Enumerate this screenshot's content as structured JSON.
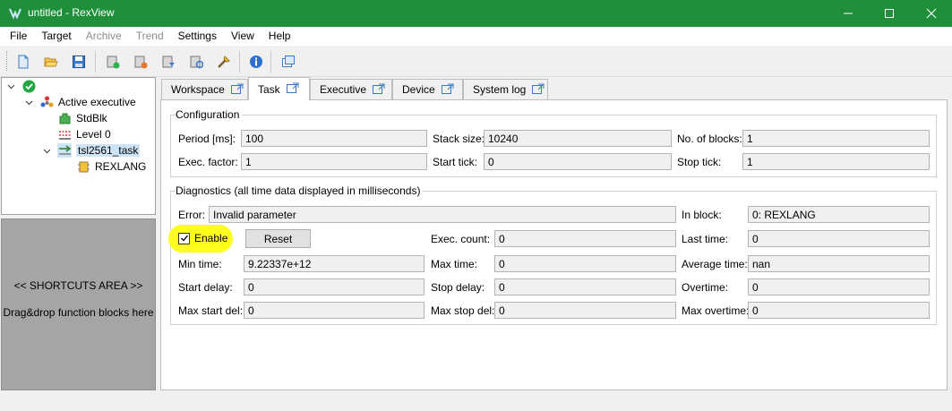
{
  "window": {
    "title": "untitled - RexView",
    "accent": "#1f8f3a"
  },
  "menu": {
    "items": [
      {
        "label": "File",
        "enabled": true
      },
      {
        "label": "Target",
        "enabled": true
      },
      {
        "label": "Archive",
        "enabled": false
      },
      {
        "label": "Trend",
        "enabled": false
      },
      {
        "label": "Settings",
        "enabled": true
      },
      {
        "label": "View",
        "enabled": true
      },
      {
        "label": "Help",
        "enabled": true
      }
    ]
  },
  "toolbar": {
    "icons": [
      "new-file-icon",
      "open-folder-icon",
      "save-icon",
      "connect-target-icon",
      "disconnect-target-icon",
      "download-icon",
      "refresh-icon",
      "settings-tool-icon",
      "info-icon",
      "window-icon"
    ]
  },
  "tree": {
    "root_label": "",
    "items": [
      {
        "label": "Active executive",
        "icon": "executive-icon"
      },
      {
        "label": "StdBlk",
        "icon": "puzzle-icon"
      },
      {
        "label": "Level 0",
        "icon": "level-icon"
      },
      {
        "label": "tsl2561_task",
        "icon": "task-icon"
      },
      {
        "label": "REXLANG",
        "icon": "block-icon"
      }
    ]
  },
  "shortcuts": {
    "title": "<< SHORTCUTS AREA >>",
    "hint": "Drag&drop function blocks here"
  },
  "tabs": [
    {
      "label": "Workspace",
      "active": false
    },
    {
      "label": "Task",
      "active": true
    },
    {
      "label": "Executive",
      "active": false
    },
    {
      "label": "Device",
      "active": false
    },
    {
      "label": "System log",
      "active": false
    }
  ],
  "configuration": {
    "title": "Configuration",
    "period_label": "Period [ms]:",
    "period_value": "100",
    "stack_label": "Stack size:",
    "stack_value": "10240",
    "blocks_label": "No. of blocks:",
    "blocks_value": "1",
    "exec_factor_label": "Exec. factor:",
    "exec_factor_value": "1",
    "start_tick_label": "Start tick:",
    "start_tick_value": "0",
    "stop_tick_label": "Stop tick:",
    "stop_tick_value": "1"
  },
  "diagnostics": {
    "title": "Diagnostics (all time data displayed in milliseconds)",
    "error_label": "Error:",
    "error_value": "Invalid parameter",
    "in_block_label": "In block:",
    "in_block_value": "0: REXLANG",
    "enable_label": "Enable",
    "enable_checked": true,
    "highlight_color": "#ffff1e",
    "reset_label": "Reset",
    "exec_count_label": "Exec. count:",
    "exec_count_value": "0",
    "last_time_label": "Last time:",
    "last_time_value": "0",
    "min_time_label": "Min time:",
    "min_time_value": "9.22337e+12",
    "max_time_label": "Max time:",
    "max_time_value": "0",
    "avg_time_label": "Average time:",
    "avg_time_value": "nan",
    "start_delay_label": "Start delay:",
    "start_delay_value": "0",
    "stop_delay_label": "Stop delay:",
    "stop_delay_value": "0",
    "overtime_label": "Overtime:",
    "overtime_value": "0",
    "max_start_del_label": "Max start del:",
    "max_start_del_value": "0",
    "max_stop_del_label": "Max stop del:",
    "max_stop_del_value": "0",
    "max_overtime_label": "Max overtime:",
    "max_overtime_value": "0"
  }
}
